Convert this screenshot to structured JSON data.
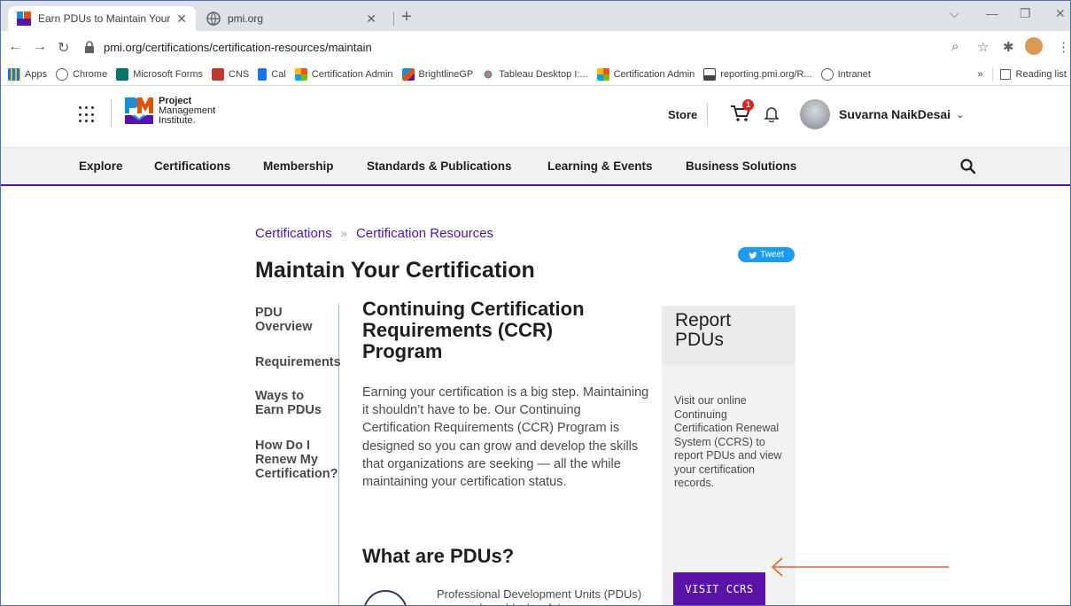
{
  "browser": {
    "tabs": [
      {
        "title": "Earn PDUs to Maintain Your Certi",
        "active": true
      },
      {
        "title": "pmi.org",
        "active": false
      }
    ],
    "address": "pmi.org/certifications/certification-resources/maintain",
    "bookmarks": [
      {
        "label": "Apps",
        "icon": "apps-grid-icon",
        "color": "#f4a300"
      },
      {
        "label": "Chrome",
        "icon": "globe-icon",
        "color": "#5f6368"
      },
      {
        "label": "Microsoft Forms",
        "icon": "forms-icon",
        "color": "#077568"
      },
      {
        "label": "CNS",
        "icon": "cns-icon",
        "color": "#c0392b"
      },
      {
        "label": "Cal",
        "icon": "cal-icon",
        "color": "#1a73e8"
      },
      {
        "label": "Certification Admin",
        "icon": "salesforce-grid-icon",
        "color": "#f25022"
      },
      {
        "label": "BrightlineGP",
        "icon": "pmi-icon",
        "color": "#e65100"
      },
      {
        "label": "Tableau Desktop I:...",
        "icon": "tableau-icon",
        "color": "#e97627"
      },
      {
        "label": "Certification Admin",
        "icon": "salesforce-grid-icon",
        "color": "#f25022"
      },
      {
        "label": "reporting.pmi.org/R...",
        "icon": "report-icon",
        "color": "#444444"
      },
      {
        "label": "Intranet",
        "icon": "globe-icon",
        "color": "#5f6368"
      }
    ],
    "overflow": "»",
    "reading_list": "Reading list"
  },
  "header": {
    "logo": {
      "line1": "Project",
      "line2": "Management",
      "line3": "Institute."
    },
    "store": "Store",
    "cart_count": "1",
    "user_name": "Suvarna NaikDesai",
    "nav": [
      "Explore",
      "Certifications",
      "Membership",
      "Standards & Publications",
      "Learning & Events",
      "Business Solutions"
    ]
  },
  "breadcrumb": {
    "items": [
      "Certifications",
      "Certification Resources"
    ],
    "separator": "»"
  },
  "tweet_label": "Tweet",
  "page_title": "Maintain Your Certification",
  "sidenav": [
    "PDU\nOverview",
    "Requirements",
    "Ways to\nEarn PDUs",
    "How Do I\nRenew My\nCertification?"
  ],
  "main": {
    "heading": "Continuing Certification\nRequirements (CCR)\nProgram",
    "paragraph": "Earning your certification is a big step. Maintaining it shouldn’t have to be. Our Continuing Certification Requirements (CCR) Program is designed so you can grow and develop the skills that organizations are seeking — all the while maintaining your certification status.",
    "pdus_heading": "What are PDUs?",
    "pdus_text": "Professional Development Units (PDUs) are one-hour blocks of time"
  },
  "report": {
    "title": "Report\nPDUs",
    "body": "Visit our online Continuing Certification Renewal System (CCRS) to report PDUs and view your certification records.",
    "button": "VISIT CCRS"
  },
  "colors": {
    "brand_purple": "#4f17a8",
    "button_purple": "#5b12a8",
    "annotation_arrow": "#e8602c",
    "tweet_blue": "#1d9bf0"
  }
}
